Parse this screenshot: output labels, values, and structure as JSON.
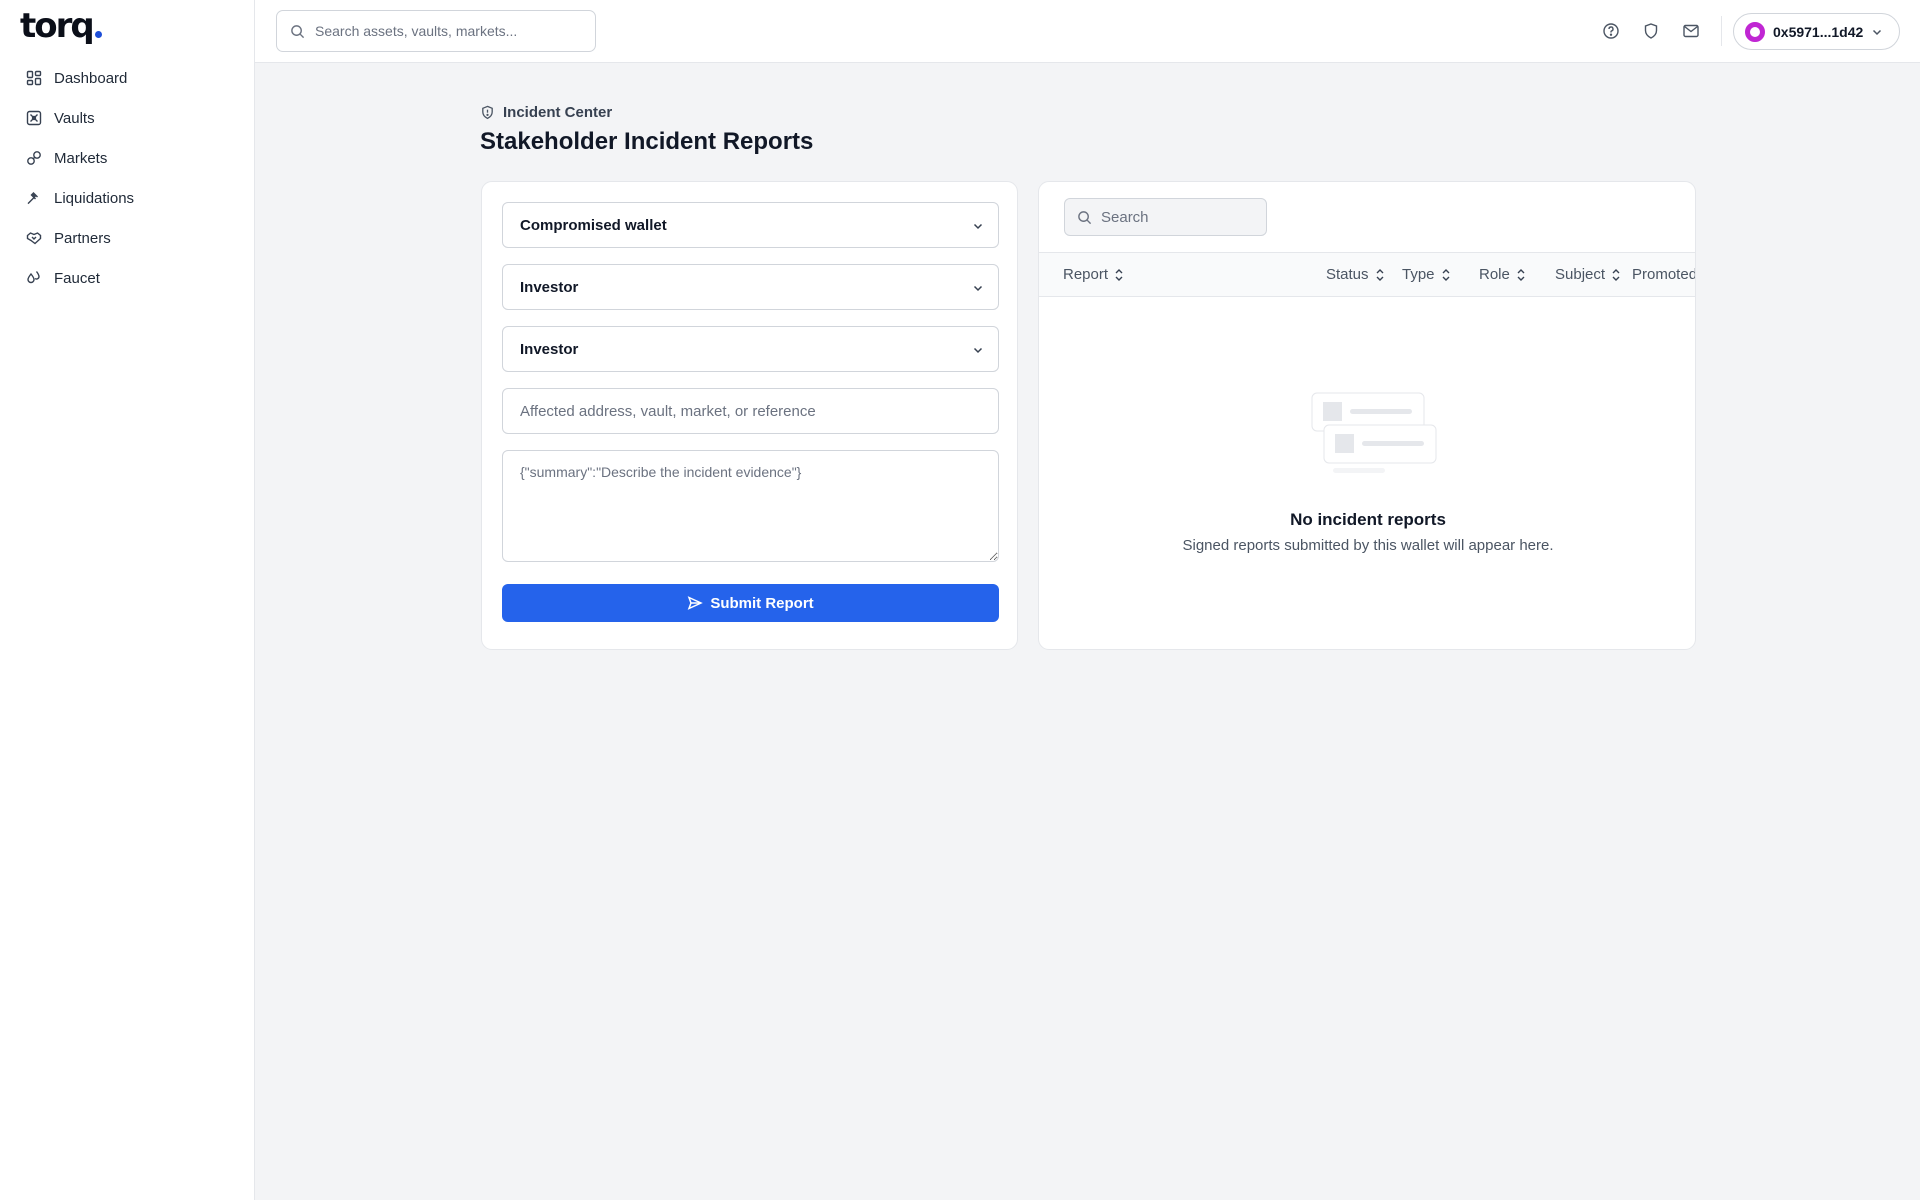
{
  "brand": {
    "logo_text": "torq",
    "accent": "#2563eb"
  },
  "sidebar": {
    "items": [
      {
        "label": "Dashboard",
        "icon": "grid-icon"
      },
      {
        "label": "Vaults",
        "icon": "vault-icon"
      },
      {
        "label": "Markets",
        "icon": "link-icon"
      },
      {
        "label": "Liquidations",
        "icon": "gavel-icon"
      },
      {
        "label": "Partners",
        "icon": "handshake-icon"
      },
      {
        "label": "Faucet",
        "icon": "droplets-icon"
      }
    ]
  },
  "topbar": {
    "search_placeholder": "Search assets, vaults, markets...",
    "icons": [
      "help-icon",
      "shield-icon",
      "mail-icon"
    ],
    "wallet": {
      "address": "0x5971...1d42",
      "avatar_color": "#c026d3"
    }
  },
  "page": {
    "breadcrumb": "Incident Center",
    "title": "Stakeholder Incident Reports"
  },
  "form": {
    "incident_type": "Compromised wallet",
    "reporter_role": "Investor",
    "subject_role": "Investor",
    "reference_placeholder": "Affected address, vault, market, or reference",
    "evidence_placeholder": "{\"summary\":\"Describe the incident evidence\"}",
    "submit_label": "Submit Report"
  },
  "reports": {
    "search_placeholder": "Search",
    "columns": [
      "Report",
      "Status",
      "Type",
      "Role",
      "Subject",
      "Promoted"
    ],
    "empty_title": "No incident reports",
    "empty_subtitle": "Signed reports submitted by this wallet will appear here.",
    "rows": []
  }
}
